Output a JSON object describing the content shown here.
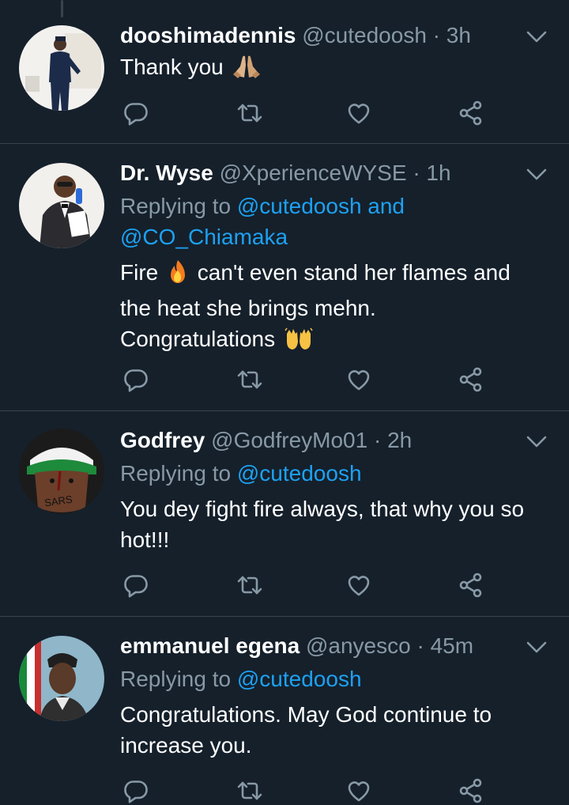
{
  "tweets": [
    {
      "name": "dooshimadennis",
      "handle": "@cutedoosh",
      "dot": "·",
      "time": "3h",
      "replying_prefix": "",
      "replying_to": "",
      "text": "Thank you",
      "avatar_icon": "avatar-photo",
      "emoji_icon": "folded-hands-emoji"
    },
    {
      "name": "Dr. Wyse",
      "handle": "@XperienceWYSE",
      "dot": "·",
      "time": "1h",
      "replying_prefix": "Replying to",
      "replying_to": "@cutedoosh and",
      "replying_to_2": "@CO_Chiamaka",
      "text_1": "Fire",
      "text_2": "can't even stand her flames and",
      "text_3": "the heat she brings mehn.",
      "text_4": "Congratulations",
      "emoji_icon": "fire-emoji",
      "emoji_icon_2": "raising-hands-emoji"
    },
    {
      "name": "Godfrey",
      "handle": "@GodfreyMo01",
      "dot": "·",
      "time": "2h",
      "replying_prefix": "Replying to",
      "replying_to": "@cutedoosh",
      "text_1": "You dey fight fire always, that why you so",
      "text_2": "hot!!!"
    },
    {
      "name": "emmanuel egena",
      "handle": "@anyesco",
      "dot": "·",
      "time": "45m",
      "replying_prefix": "Replying to",
      "replying_to": "@cutedoosh",
      "text_1": "Congratulations. May God continue to",
      "text_2": "increase you."
    }
  ],
  "colors": {
    "background": "#15202b",
    "secondary_text": "#8899a6",
    "link": "#1da1f2",
    "separator": "#38444d"
  },
  "icons": [
    "reply-icon",
    "retweet-icon",
    "like-icon",
    "share-icon",
    "chevron-down-icon"
  ]
}
